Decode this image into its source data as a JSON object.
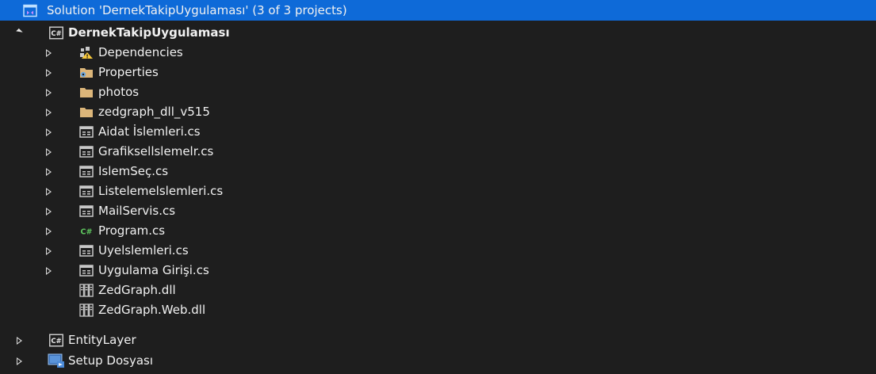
{
  "solution": {
    "label": "Solution 'DernekTakipUygulaması' (3 of 3 projects)"
  },
  "project_main": {
    "label": "DernekTakipUygulaması",
    "icon": "csharp-project-icon"
  },
  "items": [
    {
      "label": "Dependencies",
      "icon": "dependencies-icon"
    },
    {
      "label": "Properties",
      "icon": "properties-folder-icon"
    },
    {
      "label": "photos",
      "icon": "folder-icon"
    },
    {
      "label": "zedgraph_dll_v515",
      "icon": "folder-icon"
    },
    {
      "label": "Aidat İslemleri.cs",
      "icon": "form-file-icon"
    },
    {
      "label": "Grafiksellslemelr.cs",
      "icon": "form-file-icon"
    },
    {
      "label": "IslemSeç.cs",
      "icon": "form-file-icon"
    },
    {
      "label": "Listelemelslemleri.cs",
      "icon": "form-file-icon"
    },
    {
      "label": "MailServis.cs",
      "icon": "form-file-icon"
    },
    {
      "label": "Program.cs",
      "icon": "csharp-file-icon"
    },
    {
      "label": "Uyelslemleri.cs",
      "icon": "form-file-icon"
    },
    {
      "label": "Uygulama Girişi.cs",
      "icon": "form-file-icon"
    },
    {
      "label": "ZedGraph.dll",
      "icon": "dll-file-icon"
    },
    {
      "label": "ZedGraph.Web.dll",
      "icon": "dll-file-icon"
    }
  ],
  "project_entity": {
    "label": "EntityLayer",
    "icon": "csharp-project-icon"
  },
  "project_setup": {
    "label": "Setup Dosyası",
    "icon": "setup-project-icon"
  },
  "icon_glyphs": {
    "csharp": "C#"
  },
  "colors": {
    "background": "#1e1e1e",
    "selection": "#0e6ad8",
    "text": "#f1f1f1",
    "folder": "#dcb67a",
    "csharp_green": "#5fc85f"
  }
}
